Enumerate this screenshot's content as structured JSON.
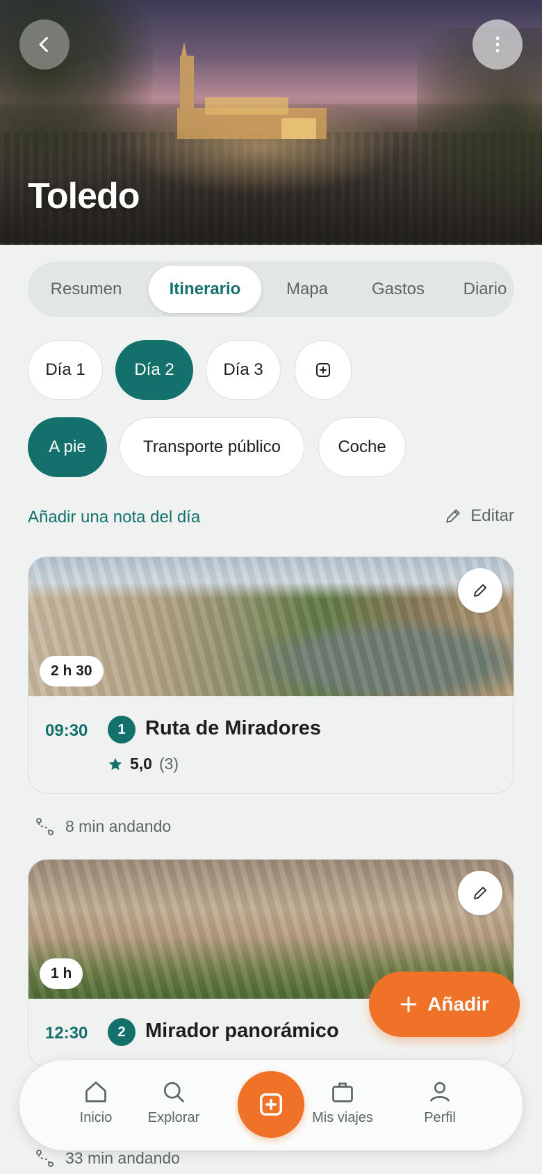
{
  "hero": {
    "title": "Toledo"
  },
  "tabs": [
    {
      "label": "Resumen",
      "active": false
    },
    {
      "label": "Itinerario",
      "active": true
    },
    {
      "label": "Mapa",
      "active": false
    },
    {
      "label": "Gastos",
      "active": false
    },
    {
      "label": "Diario",
      "active": false
    }
  ],
  "days": [
    {
      "label": "Día 1",
      "active": false
    },
    {
      "label": "Día 2",
      "active": true
    },
    {
      "label": "Día 3",
      "active": false
    }
  ],
  "transport": [
    {
      "label": "A pie",
      "active": true
    },
    {
      "label": "Transporte público",
      "active": false
    },
    {
      "label": "Coche",
      "active": false
    }
  ],
  "note": {
    "add_label": "Añadir una nota del día",
    "edit_label": "Editar"
  },
  "stops": [
    {
      "duration": "2 h 30",
      "time": "09:30",
      "number": "1",
      "name": "Ruta de Miradores",
      "rating": "5,0",
      "reviews": "(3)"
    },
    {
      "duration": "1 h",
      "time": "12:30",
      "number": "2",
      "name": "Mirador panorámico"
    }
  ],
  "transfers": [
    {
      "text": "8 min andando"
    },
    {
      "text": "33 min andando"
    }
  ],
  "fab": {
    "label": "Añadir"
  },
  "nav": [
    {
      "label": "Inicio",
      "icon": "home-icon"
    },
    {
      "label": "Explorar",
      "icon": "search-icon"
    },
    {
      "label": "Mis viajes",
      "icon": "suitcase-icon"
    },
    {
      "label": "Perfil",
      "icon": "user-icon"
    }
  ],
  "colors": {
    "primary": "#14706a",
    "accent": "#f07229",
    "background": "#f0f2f1"
  }
}
